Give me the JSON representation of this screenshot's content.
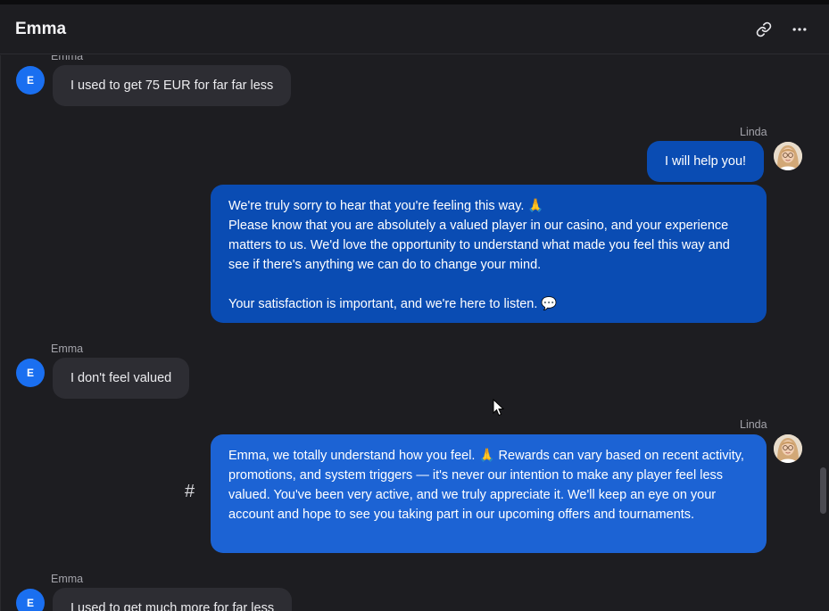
{
  "header": {
    "title": "Emma",
    "icons": [
      "link-icon",
      "more-horizontal-icon"
    ]
  },
  "messages": [
    {
      "sender": "Emma",
      "avatar_initial": "E",
      "direction": "incoming",
      "text": "I used to get 75 EUR for far far less"
    },
    {
      "sender": "Linda",
      "direction": "outgoing",
      "text": "I will help you!"
    },
    {
      "sender": "Linda",
      "direction": "outgoing",
      "text": "We're truly sorry to hear that you're feeling this way. 🙏\nPlease know that you are absolutely a valued player in our casino, and your experience matters to us. We'd love the opportunity to understand what made you feel this way and see if there's anything we can do to change your mind.\n\nYour satisfaction is important, and we're here to listen. 💬"
    },
    {
      "sender": "Emma",
      "avatar_initial": "E",
      "direction": "incoming",
      "text": "I don't feel valued"
    },
    {
      "sender": "Linda",
      "direction": "outgoing",
      "text": "Emma, we totally understand how you feel. 🙏 Rewards can vary based on recent activity, promotions, and system triggers — it's never our intention to make any player feel less valued. You've been very active, and we truly appreciate it. We'll keep an eye on your account and hope to see you taking part in our upcoming offers and tournaments."
    },
    {
      "sender": "Emma",
      "avatar_initial": "E",
      "direction": "incoming",
      "text": "I used to get much more for far less"
    }
  ],
  "hash_symbol": "#",
  "colors": {
    "background": "#1d1d21",
    "incoming_bubble": "#2d2d33",
    "outgoing_bubble": "#0a4cb3",
    "outgoing_bubble_highlight": "#1c63d4",
    "avatar_blue": "#1a6ff0"
  }
}
